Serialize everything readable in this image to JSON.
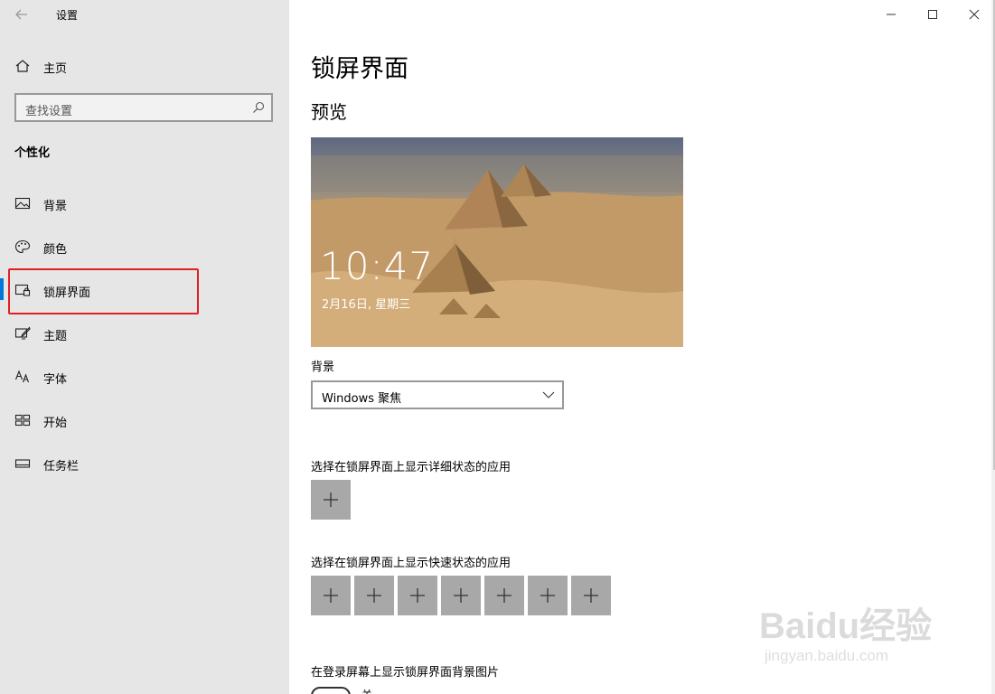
{
  "window": {
    "title": "设置",
    "controls": [
      "minimize-icon",
      "maximize-icon",
      "close-icon"
    ]
  },
  "sidebar": {
    "home_label": "主页",
    "search_placeholder": "查找设置",
    "section_title": "个性化",
    "items": [
      {
        "label": "背景",
        "icon": "image-icon"
      },
      {
        "label": "颜色",
        "icon": "palette-icon"
      },
      {
        "label": "锁屏界面",
        "icon": "lock-screen-icon",
        "selected": true
      },
      {
        "label": "主题",
        "icon": "theme-brush-icon"
      },
      {
        "label": "字体",
        "icon": "font-icon"
      },
      {
        "label": "开始",
        "icon": "start-icon"
      },
      {
        "label": "任务栏",
        "icon": "taskbar-icon"
      }
    ]
  },
  "main": {
    "title": "锁屏界面",
    "preview_heading": "预览",
    "preview": {
      "time": "10:47",
      "date": "2月16日, 星期三"
    },
    "background_label": "背景",
    "background_value": "Windows 聚焦",
    "detail_status_label": "选择在锁屏界面上显示详细状态的应用",
    "quick_status_label": "选择在锁屏界面上显示快速状态的应用",
    "login_bg_label": "在登录屏幕上显示锁屏界面背景图片",
    "login_bg_toggle_state": "关"
  },
  "watermark": {
    "brand": "Baidu经验",
    "url": "jingyan.baidu.com"
  },
  "colors": {
    "accent": "#0078d7",
    "highlight_box": "#e02020",
    "sidebar_bg": "#e6e6e6",
    "tile_gray": "#a8a8a8"
  }
}
